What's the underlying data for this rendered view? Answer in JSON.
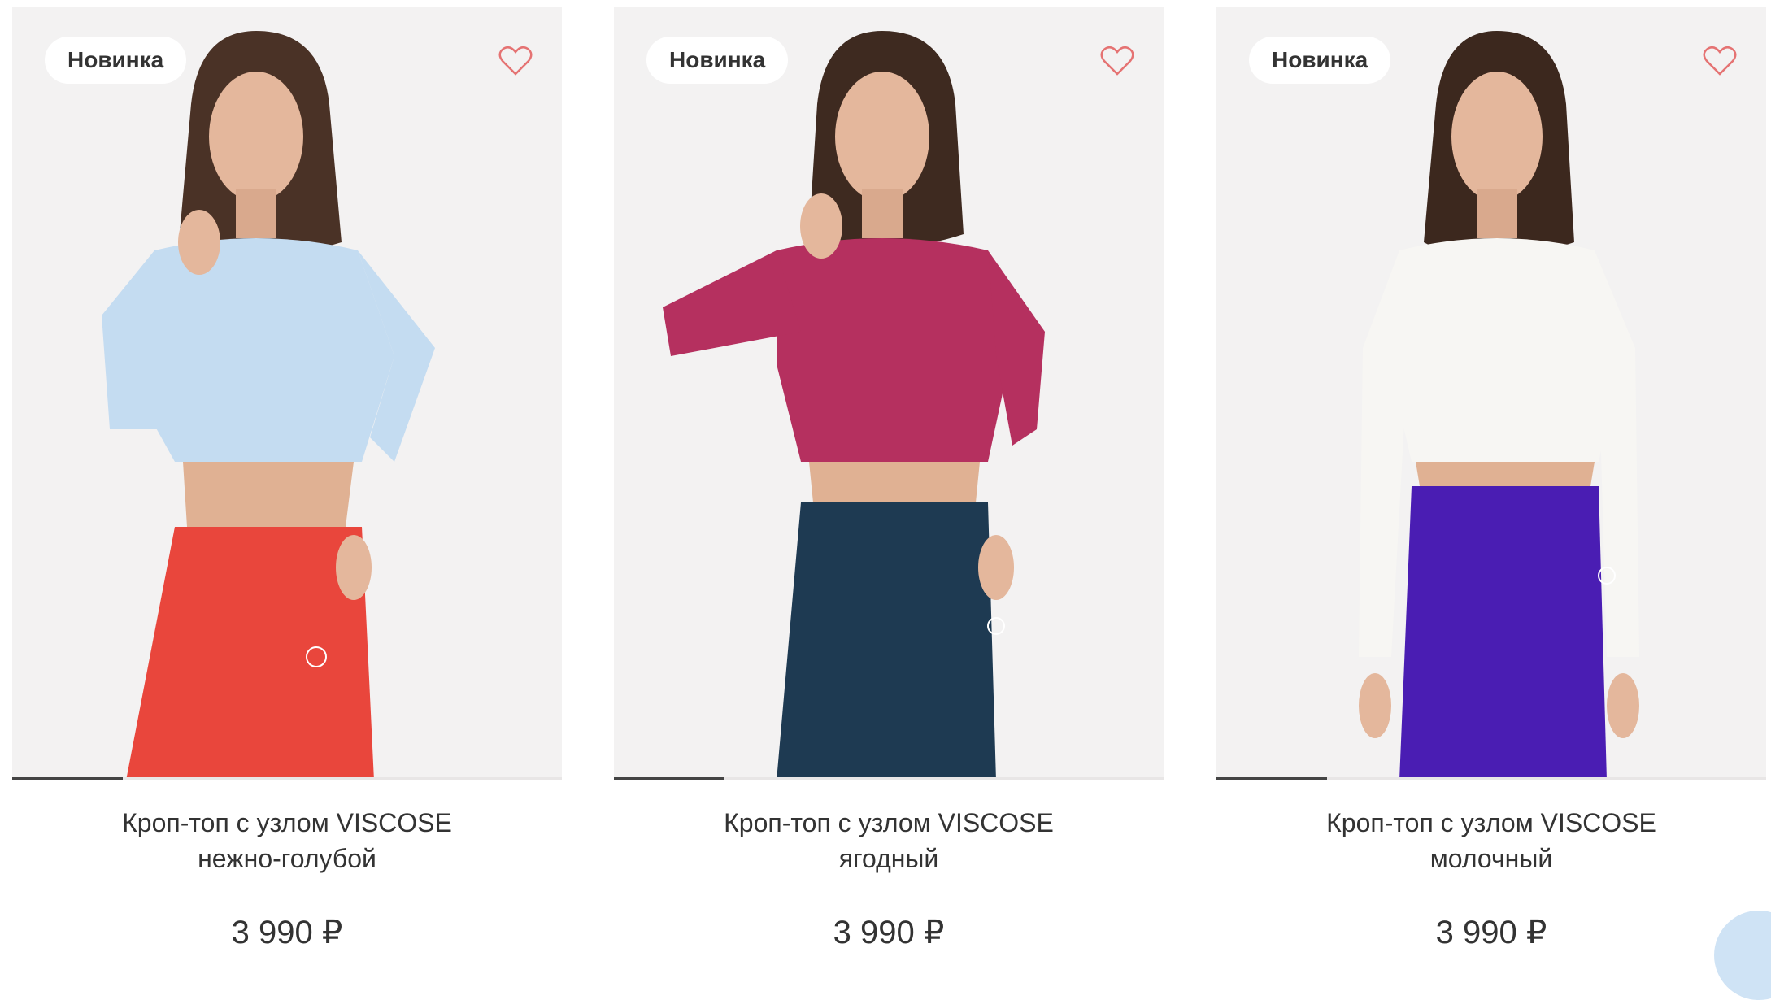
{
  "products": [
    {
      "badge": "Новинка",
      "title_line1": "Кроп-топ с узлом VISCOSE",
      "title_line2": "нежно-голубой",
      "price": "3 990 ₽",
      "top_color": "#c4dcf1",
      "bottom_color": "#e9463c",
      "hair_color": "#4a3226"
    },
    {
      "badge": "Новинка",
      "title_line1": "Кроп-топ с узлом VISCOSE",
      "title_line2": "ягодный",
      "price": "3 990 ₽",
      "top_color": "#b5305f",
      "bottom_color": "#1e3a52",
      "hair_color": "#3e2a20"
    },
    {
      "badge": "Новинка",
      "title_line1": "Кроп-топ с узлом VISCOSE",
      "title_line2": "молочный",
      "price": "3 990 ₽",
      "top_color": "#f7f6f3",
      "bottom_color": "#4a1db3",
      "hair_color": "#3c281e"
    }
  ],
  "colors": {
    "heart": "#e57373",
    "photo_bg": "#f3f2f2",
    "skin": "#e4b79c"
  },
  "icons": {
    "favorite": "heart-outline-icon"
  }
}
